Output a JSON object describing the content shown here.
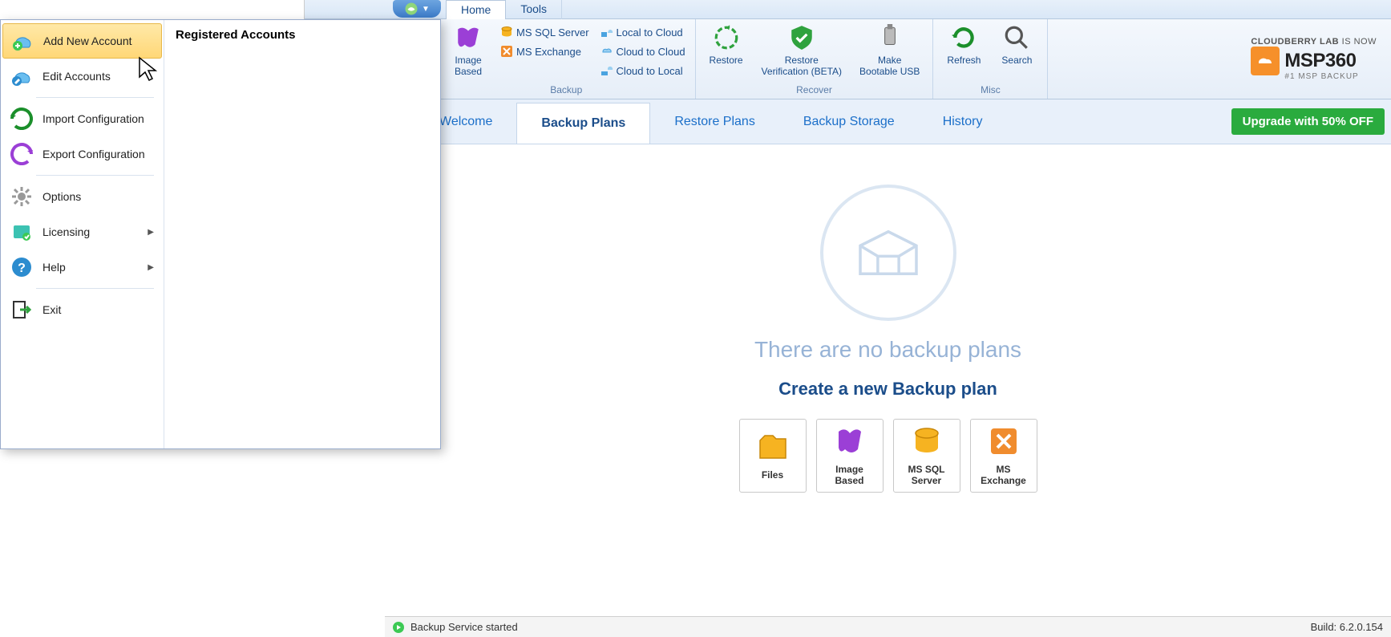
{
  "menutabs": {
    "home": "Home",
    "tools": "Tools"
  },
  "ribbon": {
    "backup_group": "Backup",
    "recover_group": "Recover",
    "misc_group": "Misc",
    "image_based": "Image\nBased",
    "ms_sql": "MS SQL Server",
    "ms_exchange": "MS Exchange",
    "local_to_cloud": "Local to Cloud",
    "cloud_to_cloud": "Cloud to Cloud",
    "cloud_to_local": "Cloud to Local",
    "restore": "Restore",
    "restore_verif": "Restore\nVerification (BETA)",
    "make_usb": "Make\nBootable USB",
    "refresh": "Refresh",
    "search": "Search"
  },
  "brand": {
    "top_a": "CLOUDBERRY LAB",
    "top_b": "IS NOW",
    "name": "MSP360",
    "sub": "#1 MSP BACKUP"
  },
  "subnav": {
    "welcome": "Welcome",
    "backup_plans": "Backup Plans",
    "restore_plans": "Restore Plans",
    "backup_storage": "Backup Storage",
    "history": "History",
    "upgrade": "Upgrade with 50% OFF"
  },
  "main": {
    "empty_title": "There are no backup plans",
    "empty_sub": "Create a new Backup plan",
    "btn_files": "Files",
    "btn_image": "Image\nBased",
    "btn_sql": "MS SQL\nServer",
    "btn_exchange": "MS\nExchange"
  },
  "status": {
    "service": "Backup Service started",
    "build": "Build: 6.2.0.154"
  },
  "menu": {
    "add_account": "Add New Account",
    "edit_accounts": "Edit Accounts",
    "import": "Import Configuration",
    "export": "Export Configuration",
    "options": "Options",
    "licensing": "Licensing",
    "help": "Help",
    "exit": "Exit",
    "accounts_header": "Registered Accounts"
  }
}
